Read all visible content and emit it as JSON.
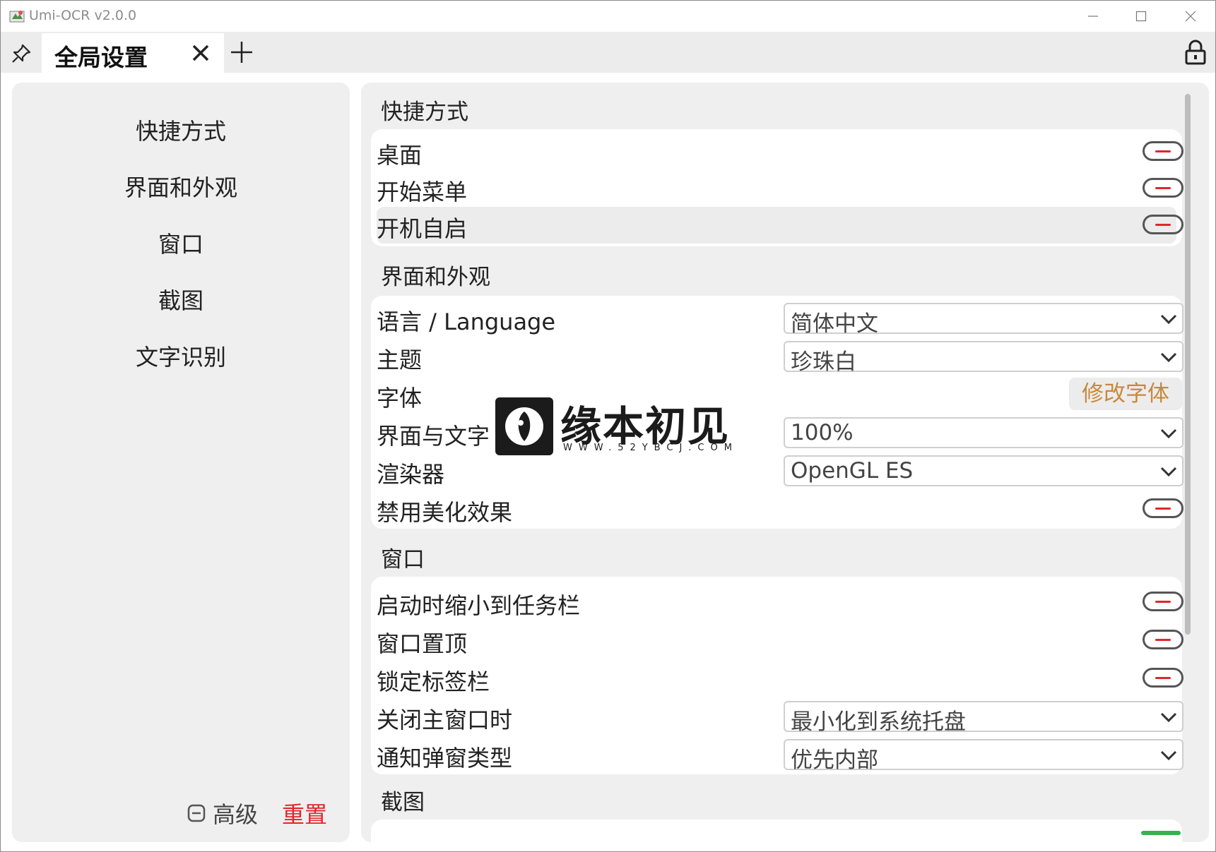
{
  "window": {
    "title": "Umi-OCR v2.0.0"
  },
  "tabs": {
    "active_label": "全局设置"
  },
  "nav": {
    "items": [
      "快捷方式",
      "界面和外观",
      "窗口",
      "截图",
      "文字识别"
    ],
    "advanced_label": "高级",
    "reset_label": "重置"
  },
  "sections": {
    "shortcuts": {
      "title": "快捷方式",
      "rows": [
        {
          "label": "桌面",
          "state": "off"
        },
        {
          "label": "开始菜单",
          "state": "off"
        },
        {
          "label": "开机自启",
          "state": "off"
        }
      ]
    },
    "appearance": {
      "title": "界面和外观",
      "language_label": "语言 / Language",
      "language_value": "简体中文",
      "theme_label": "主题",
      "theme_value": "珍珠白",
      "font_label": "字体",
      "font_button": "修改字体",
      "scale_label": "界面与文字",
      "scale_value": "100%",
      "renderer_label": "渲染器",
      "renderer_value": "OpenGL ES",
      "disable_effects_label": "禁用美化效果"
    },
    "window": {
      "title": "窗口",
      "minimize_on_start_label": "启动时缩小到任务栏",
      "always_on_top_label": "窗口置顶",
      "lock_tabbar_label": "锁定标签栏",
      "on_close_label": "关闭主窗口时",
      "on_close_value": "最小化到系统托盘",
      "notify_type_label": "通知弹窗类型",
      "notify_type_value": "优先内部"
    },
    "screenshot": {
      "title": "截图"
    }
  },
  "watermark": {
    "text": "缘本初见",
    "sub": "WWW.52YBCJ.COM"
  },
  "colors": {
    "accent_red": "#e0262d",
    "font_button": "#c8893a",
    "panel_bg": "#efefef"
  }
}
